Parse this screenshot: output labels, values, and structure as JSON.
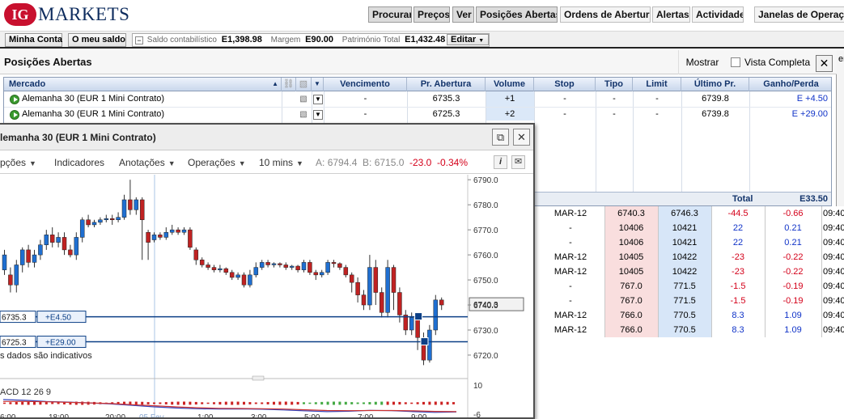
{
  "app": {
    "logo_badge": "IG",
    "logo_text": "MARKETS",
    "brand_colors": {
      "red": "#c8102e",
      "navy": "#0e2c5e"
    }
  },
  "topnav": {
    "procurar": "Procurar",
    "precos": "Preços",
    "ver": "Ver",
    "posicoes": "Posições Abertas",
    "ordens": "Ordens de Abertura",
    "alertas": "Alertas",
    "actividade": "Actividade",
    "janelas": "Janelas de Operação"
  },
  "account": {
    "minha_conta": "Minha Conta",
    "meu_saldo": "O meu saldo",
    "saldo_label": "Saldo contabilístico",
    "saldo_value": "E1,398.98",
    "margem_label": "Margem",
    "margem_value": "E90.00",
    "patrimonio_label": "Património Total",
    "patrimonio_value": "E1,432.48",
    "editar": "Editar",
    "collapse_symbol": "−"
  },
  "positions": {
    "title": "Posições Abertas",
    "mostrar": "Mostrar",
    "vista_completa": "Vista Completa",
    "close_symbol": "✕",
    "headers": {
      "mercado": "Mercado",
      "sort_arrow": "▲",
      "vencimento": "Vencimento",
      "pr_abertura": "Pr. Abertura",
      "volume": "Volume",
      "stop": "Stop",
      "tipo": "Tipo",
      "limit": "Limit",
      "ultimo_pr": "Último Pr.",
      "ganho_perda": "Ganho/Perda"
    },
    "rows": [
      {
        "mercado": "Alemanha 30 (EUR 1 Mini Contrato)",
        "vencimento": "-",
        "pr_abertura": "6735.3",
        "volume": "+1",
        "stop": "-",
        "tipo": "-",
        "limit": "-",
        "ultimo_pr": "6739.8",
        "ganho": "E +4.50"
      },
      {
        "mercado": "Alemanha 30 (EUR 1 Mini Contrato)",
        "vencimento": "-",
        "pr_abertura": "6725.3",
        "volume": "+2",
        "stop": "-",
        "tipo": "-",
        "limit": "-",
        "ultimo_pr": "6739.8",
        "ganho": "E +29.00"
      }
    ],
    "total_label": "Total",
    "total_value": "E33.50",
    "colors": {
      "header_text": "#13346b",
      "volume_bg": "#dbe8f8",
      "gain_text": "#1033c8"
    }
  },
  "market_grid": {
    "rows": [
      {
        "vencimento": "MAR-12",
        "venda": "6740.3",
        "compra": "6746.3",
        "var": "-44.5",
        "pct": "-0.66",
        "hora": "09:40"
      },
      {
        "vencimento": "-",
        "venda": "10406",
        "compra": "10421",
        "var": "22",
        "pct": "0.21",
        "hora": "09:40"
      },
      {
        "vencimento": "-",
        "venda": "10406",
        "compra": "10421",
        "var": "22",
        "pct": "0.21",
        "hora": "09:40"
      },
      {
        "vencimento": "MAR-12",
        "venda": "10405",
        "compra": "10422",
        "var": "-23",
        "pct": "-0.22",
        "hora": "09:40"
      },
      {
        "vencimento": "MAR-12",
        "venda": "10405",
        "compra": "10422",
        "var": "-23",
        "pct": "-0.22",
        "hora": "09:40"
      },
      {
        "vencimento": "-",
        "venda": "767.0",
        "compra": "771.5",
        "var": "-1.5",
        "pct": "-0.19",
        "hora": "09:40"
      },
      {
        "vencimento": "-",
        "venda": "767.0",
        "compra": "771.5",
        "var": "-1.5",
        "pct": "-0.19",
        "hora": "09:40"
      },
      {
        "vencimento": "MAR-12",
        "venda": "766.0",
        "compra": "770.5",
        "var": "8.3",
        "pct": "1.09",
        "hora": "09:40"
      },
      {
        "vencimento": "MAR-12",
        "venda": "766.0",
        "compra": "770.5",
        "var": "8.3",
        "pct": "1.09",
        "hora": "09:40"
      }
    ],
    "right_edge_cut": [
      "er",
      "",
      "e",
      "",
      "0:",
      "0:",
      "0:",
      "0:",
      "0:",
      "0:",
      "0:",
      "0:",
      "0:",
      "0:",
      "0:",
      "0:",
      "0:"
    ],
    "colors": {
      "sell_bg": "#f9dede",
      "buy_bg": "#d7e6f8",
      "neg": "#d4001a",
      "pos": "#1033c8"
    }
  },
  "chart_window": {
    "title": "lemanha 30 (EUR 1 Mini Contrato)",
    "popout_symbol": "⧉",
    "close_symbol": "✕",
    "toolbar": {
      "opcoes": "pções",
      "indicadores": "Indicadores",
      "anotacoes": "Anotações",
      "operacoes": "Operações",
      "interval": "10 mins",
      "ask_label": "A:",
      "ask": "6794.4",
      "bid_label": "B:",
      "bid": "6715.0",
      "change": "-23.0",
      "change_pct": "-0.34%",
      "dropdown_arrow": "▼",
      "info_symbol": "i",
      "mail_symbol": "✉"
    },
    "disclaimer": "s dados são indicativos",
    "price_tag": "6740.3",
    "positions": [
      {
        "price_label": "6735.3",
        "pnl_label": "+E4.50",
        "level": 6735.3
      },
      {
        "price_label": "6725.3",
        "pnl_label": "+E29.00",
        "level": 6725.3
      }
    ],
    "macd_label": "ACD  12  26  9",
    "macd_ticks": [
      "10",
      "-6"
    ],
    "time_labels": [
      "6:00",
      "18:00",
      "20:00",
      "05 Fev",
      "1:00",
      "3:00",
      "5:00",
      "7:00",
      "9:00"
    ],
    "colors": {
      "up": "#1f6fd1",
      "down": "#c02222",
      "level_line": "#0b3f86",
      "position_box": "#0b3f86"
    }
  },
  "chart_data": {
    "type": "candlestick",
    "title": "lemanha 30 (EUR 1 Mini Contrato)",
    "y_ticks": [
      6790.0,
      6780.0,
      6770.0,
      6760.0,
      6750.0,
      6740.0,
      6730.0,
      6720.0
    ],
    "ylim": [
      6714.5,
      6792
    ],
    "x_tick_labels": [
      "6:00",
      "18:00",
      "20:00",
      "05 Fev",
      "1:00",
      "3:00",
      "5:00",
      "7:00",
      "9:00"
    ],
    "candles": [
      {
        "o": 6754,
        "c": 6760,
        "h": 6762,
        "l": 6752
      },
      {
        "o": 6752,
        "c": 6748,
        "h": 6755,
        "l": 6745
      },
      {
        "o": 6748,
        "c": 6756,
        "h": 6758,
        "l": 6745
      },
      {
        "o": 6756,
        "c": 6762,
        "h": 6763,
        "l": 6753
      },
      {
        "o": 6762,
        "c": 6757,
        "h": 6764,
        "l": 6755
      },
      {
        "o": 6757,
        "c": 6760,
        "h": 6762,
        "l": 6755
      },
      {
        "o": 6760,
        "c": 6764,
        "h": 6766,
        "l": 6758
      },
      {
        "o": 6764,
        "c": 6768,
        "h": 6770,
        "l": 6762
      },
      {
        "o": 6768,
        "c": 6765,
        "h": 6771,
        "l": 6763
      },
      {
        "o": 6765,
        "c": 6767,
        "h": 6769,
        "l": 6763
      },
      {
        "o": 6767,
        "c": 6762,
        "h": 6769,
        "l": 6760
      },
      {
        "o": 6762,
        "c": 6760,
        "h": 6764,
        "l": 6759
      },
      {
        "o": 6760,
        "c": 6767,
        "h": 6769,
        "l": 6758
      },
      {
        "o": 6767,
        "c": 6774,
        "h": 6775,
        "l": 6765
      },
      {
        "o": 6774,
        "c": 6772,
        "h": 6776,
        "l": 6771
      },
      {
        "o": 6772,
        "c": 6773,
        "h": 6774,
        "l": 6771
      },
      {
        "o": 6773,
        "c": 6774,
        "h": 6775,
        "l": 6772
      },
      {
        "o": 6774,
        "c": 6774.5,
        "h": 6776,
        "l": 6773
      },
      {
        "o": 6774.5,
        "c": 6774,
        "h": 6776,
        "l": 6772
      },
      {
        "o": 6774,
        "c": 6775,
        "h": 6777,
        "l": 6773
      },
      {
        "o": 6775,
        "c": 6782,
        "h": 6784,
        "l": 6774
      },
      {
        "o": 6782,
        "c": 6778,
        "h": 6790,
        "l": 6776
      },
      {
        "o": 6778,
        "c": 6782,
        "h": 6783,
        "l": 6776
      },
      {
        "o": 6782,
        "c": 6774,
        "h": 6783,
        "l": 6758
      },
      {
        "o": 6769,
        "c": 6765,
        "h": 6770,
        "l": 6758
      },
      {
        "o": 6766,
        "c": 6768,
        "h": 6769,
        "l": 6765
      },
      {
        "o": 6768,
        "c": 6767,
        "h": 6769,
        "l": 6766
      },
      {
        "o": 6767,
        "c": 6769,
        "h": 6771,
        "l": 6766
      },
      {
        "o": 6769,
        "c": 6770,
        "h": 6772,
        "l": 6768
      },
      {
        "o": 6770,
        "c": 6769,
        "h": 6771,
        "l": 6768
      },
      {
        "o": 6769,
        "c": 6770,
        "h": 6771,
        "l": 6768
      },
      {
        "o": 6770,
        "c": 6763,
        "h": 6771,
        "l": 6762
      },
      {
        "o": 6762,
        "c": 6758,
        "h": 6763,
        "l": 6756
      },
      {
        "o": 6758,
        "c": 6756,
        "h": 6759,
        "l": 6755
      },
      {
        "o": 6756,
        "c": 6755,
        "h": 6757,
        "l": 6754
      },
      {
        "o": 6755,
        "c": 6754,
        "h": 6756,
        "l": 6753
      },
      {
        "o": 6754,
        "c": 6754.5,
        "h": 6756,
        "l": 6753
      },
      {
        "o": 6754.5,
        "c": 6753,
        "h": 6755,
        "l": 6752
      },
      {
        "o": 6753,
        "c": 6751,
        "h": 6754,
        "l": 6750
      },
      {
        "o": 6751,
        "c": 6752,
        "h": 6753,
        "l": 6750
      },
      {
        "o": 6752,
        "c": 6748,
        "h": 6753,
        "l": 6747
      },
      {
        "o": 6748,
        "c": 6752,
        "h": 6754,
        "l": 6747
      },
      {
        "o": 6752,
        "c": 6755,
        "h": 6757,
        "l": 6751
      },
      {
        "o": 6755,
        "c": 6757,
        "h": 6758,
        "l": 6754
      },
      {
        "o": 6757,
        "c": 6756,
        "h": 6758,
        "l": 6755
      },
      {
        "o": 6756,
        "c": 6756.5,
        "h": 6757,
        "l": 6755
      },
      {
        "o": 6756.5,
        "c": 6756,
        "h": 6757,
        "l": 6755
      },
      {
        "o": 6756,
        "c": 6755,
        "h": 6757,
        "l": 6754
      },
      {
        "o": 6755,
        "c": 6755.5,
        "h": 6756,
        "l": 6754
      },
      {
        "o": 6755.5,
        "c": 6754,
        "h": 6756,
        "l": 6753
      },
      {
        "o": 6754,
        "c": 6757,
        "h": 6758,
        "l": 6753
      },
      {
        "o": 6757,
        "c": 6753,
        "h": 6758,
        "l": 6752
      },
      {
        "o": 6753,
        "c": 6752,
        "h": 6754,
        "l": 6750
      },
      {
        "o": 6752,
        "c": 6753,
        "h": 6754,
        "l": 6751
      },
      {
        "o": 6753,
        "c": 6757,
        "h": 6758,
        "l": 6752
      },
      {
        "o": 6757,
        "c": 6756.5,
        "h": 6758,
        "l": 6755
      },
      {
        "o": 6756.5,
        "c": 6755,
        "h": 6757,
        "l": 6754
      },
      {
        "o": 6755,
        "c": 6752,
        "h": 6756,
        "l": 6751
      },
      {
        "o": 6752,
        "c": 6749,
        "h": 6753,
        "l": 6745
      },
      {
        "o": 6749,
        "c": 6744,
        "h": 6751,
        "l": 6741
      },
      {
        "o": 6744,
        "c": 6740,
        "h": 6746,
        "l": 6738
      },
      {
        "o": 6740,
        "c": 6755,
        "h": 6760,
        "l": 6738
      },
      {
        "o": 6755,
        "c": 6745,
        "h": 6758,
        "l": 6740
      },
      {
        "o": 6745,
        "c": 6737,
        "h": 6747,
        "l": 6735
      },
      {
        "o": 6737,
        "c": 6755,
        "h": 6758,
        "l": 6735
      },
      {
        "o": 6755,
        "c": 6745,
        "h": 6756,
        "l": 6738
      },
      {
        "o": 6745,
        "c": 6736,
        "h": 6747,
        "l": 6733
      },
      {
        "o": 6736,
        "c": 6730,
        "h": 6738,
        "l": 6728
      },
      {
        "o": 6730,
        "c": 6735,
        "h": 6737,
        "l": 6728
      },
      {
        "o": 6735,
        "c": 6727,
        "h": 6736,
        "l": 6722
      },
      {
        "o": 6727,
        "c": 6718,
        "h": 6729,
        "l": 6716
      },
      {
        "o": 6718,
        "c": 6730,
        "h": 6732,
        "l": 6717
      },
      {
        "o": 6730,
        "c": 6742,
        "h": 6744,
        "l": 6728
      },
      {
        "o": 6742,
        "c": 6740,
        "h": 6743,
        "l": 6738
      }
    ],
    "position_levels": [
      6735.3,
      6725.3
    ],
    "last_price": 6740.3,
    "macd": {
      "label": "ACD 12 26 9",
      "ylim": [
        -6,
        10
      ],
      "y_ticks": [
        10,
        -6
      ],
      "macd_line": [
        2.0,
        1.6,
        1.0,
        0.6,
        0.2,
        -0.4,
        -1.2,
        -2.0,
        -2.6,
        -3.0,
        -3.2,
        -3.1,
        -3.3,
        -3.7,
        -4.2,
        -4.6,
        -4.4,
        -3.9,
        -4.1,
        -4.6,
        -5.0,
        -4.8
      ],
      "signal_line": [
        1.0,
        1.0,
        0.8,
        0.5,
        0.2,
        -0.2,
        -0.8,
        -1.4,
        -2.0,
        -2.5,
        -2.8,
        -2.9,
        -3.0,
        -3.2,
        -3.6,
        -4.0,
        -4.1,
        -4.0,
        -4.0,
        -4.2,
        -4.5,
        -4.6
      ]
    }
  }
}
